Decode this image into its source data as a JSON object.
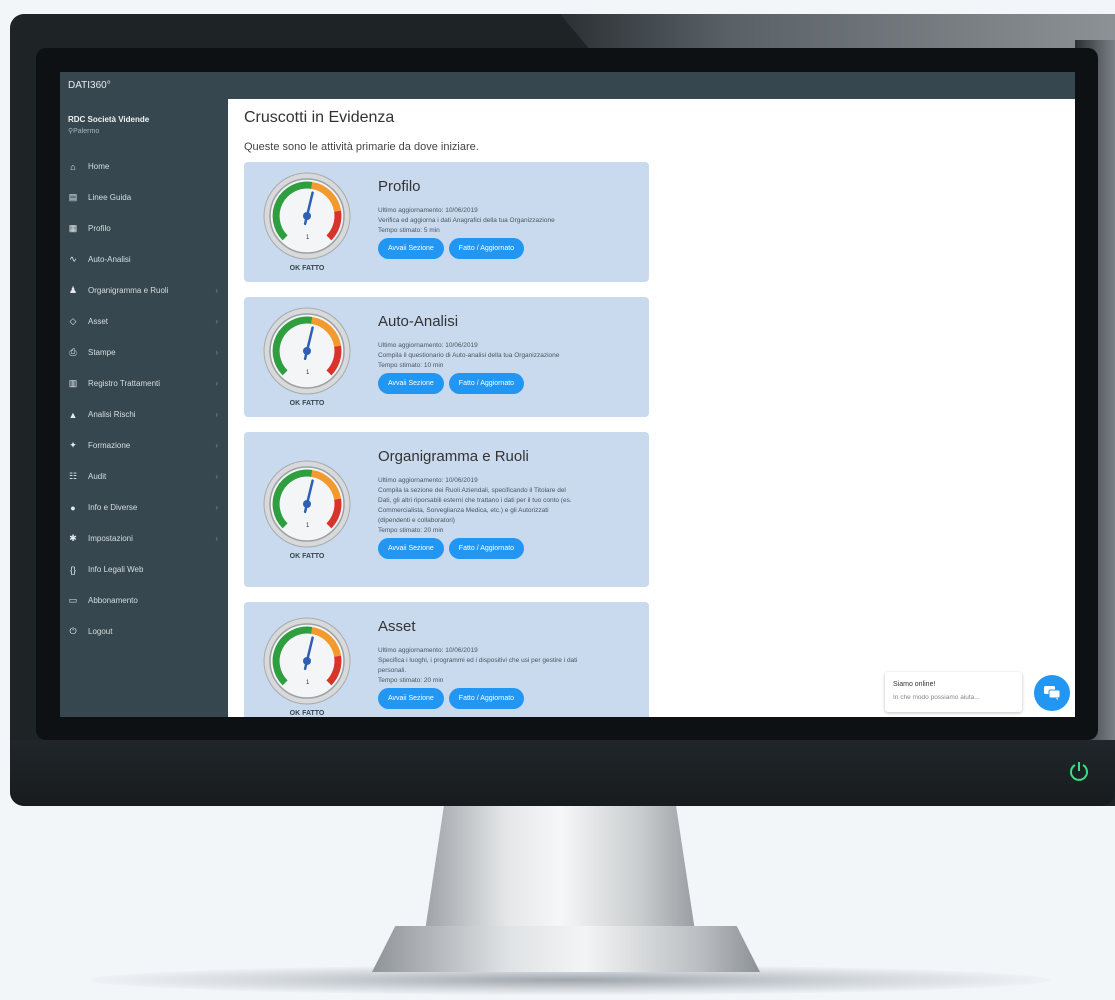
{
  "app": {
    "brand": "DATI360°"
  },
  "user": {
    "name": "RDC Società Vidende",
    "location": "Palermo"
  },
  "sidebar": {
    "items": [
      {
        "label": "Home",
        "icon": "home-icon",
        "glyph": "⌂",
        "chevron": false
      },
      {
        "label": "Linee Guida",
        "icon": "document-icon",
        "glyph": "▤",
        "chevron": false
      },
      {
        "label": "Profilo",
        "icon": "profile-card-icon",
        "glyph": "▦",
        "chevron": false
      },
      {
        "label": "Auto-Analisi",
        "icon": "trend-icon",
        "glyph": "∿",
        "chevron": false
      },
      {
        "label": "Organigramma e Ruoli",
        "icon": "organization-icon",
        "glyph": "♟",
        "chevron": true
      },
      {
        "label": "Asset",
        "icon": "asset-icon",
        "glyph": "◇",
        "chevron": true
      },
      {
        "label": "Stampe",
        "icon": "print-icon",
        "glyph": "⎙",
        "chevron": true
      },
      {
        "label": "Registro Trattamenti",
        "icon": "register-icon",
        "glyph": "▥",
        "chevron": true
      },
      {
        "label": "Analisi Rischi",
        "icon": "warning-icon",
        "glyph": "▲",
        "chevron": true
      },
      {
        "label": "Formazione",
        "icon": "training-icon",
        "glyph": "✦",
        "chevron": true
      },
      {
        "label": "Audit",
        "icon": "audit-icon",
        "glyph": "☷",
        "chevron": true
      },
      {
        "label": "Info e Diverse",
        "icon": "info-icon",
        "glyph": "●",
        "chevron": true
      },
      {
        "label": "Impostazioni",
        "icon": "settings-icon",
        "glyph": "✱",
        "chevron": true
      },
      {
        "label": "Info Legali Web",
        "icon": "code-icon",
        "glyph": "{}",
        "chevron": false
      },
      {
        "label": "Abbonamento",
        "icon": "subscription-icon",
        "glyph": "▭",
        "chevron": false
      },
      {
        "label": "Logout",
        "icon": "logout-icon",
        "glyph": "⏻",
        "chevron": false
      }
    ]
  },
  "main": {
    "title": "Cruscotti in Evidenza",
    "subtitle": "Queste sono le attività primarie da dove iniziare."
  },
  "cards": [
    {
      "title": "Profilo",
      "gauge_label": "OK FATTO",
      "gauge_level": 0.55,
      "lines": [
        "Ultimo aggiornamento: 10/06/2019",
        "Verifica ed aggiorna i dati Anagrafici della tua Organizzazione",
        "Tempo stimato: 5 min"
      ],
      "btn_primary": "Avvaii Sezione",
      "btn_secondary": "Fatto / Aggiornato"
    },
    {
      "title": "Auto-Analisi",
      "gauge_label": "OK FATTO",
      "gauge_level": 0.55,
      "lines": [
        "Ultimo aggiornamento: 10/06/2019",
        "Compila il questionario di Auto-analisi della tua Organizzazione",
        "Tempo stimato: 10 min"
      ],
      "btn_primary": "Avvaii Sezione",
      "btn_secondary": "Fatto / Aggiornato"
    },
    {
      "title": "Organigramma e Ruoli",
      "gauge_label": "OK FATTO",
      "gauge_level": 0.55,
      "lines": [
        "Ultimo aggiornamento: 10/06/2019",
        "Compila la sezione dei Ruoli Aziendali, specificando il Titolare del",
        "Dati, gli altri riporsabili esterni che trattano i dati per il tuo conto (es.",
        "Commercialista, Sorveglianza Medica, etc.) e gli Autorizzati",
        "(dipendenti e collaboratori)",
        "Tempo stimato: 20 min"
      ],
      "btn_primary": "Avvaii Sezione",
      "btn_secondary": "Fatto / Aggiornato"
    },
    {
      "title": "Asset",
      "gauge_label": "OK FATTO",
      "gauge_level": 0.55,
      "lines": [
        "Ultimo aggiornamento: 10/06/2019",
        "Specifica i luoghi, i programmi ed i dispositivi che usi per gestire i dati",
        "personali.",
        "Tempo stimato: 20 min"
      ],
      "btn_primary": "Avvaii Sezione",
      "btn_secondary": "Fatto / Aggiornato"
    }
  ],
  "chat": {
    "title": "Siamo online!",
    "subtitle": "In che modo possiamo aiuta...",
    "icon": "chat-icon"
  },
  "colors": {
    "sidebar": "#37474f",
    "accent": "#2196f3",
    "card": "#c9daee",
    "power": "#3ddc84"
  }
}
